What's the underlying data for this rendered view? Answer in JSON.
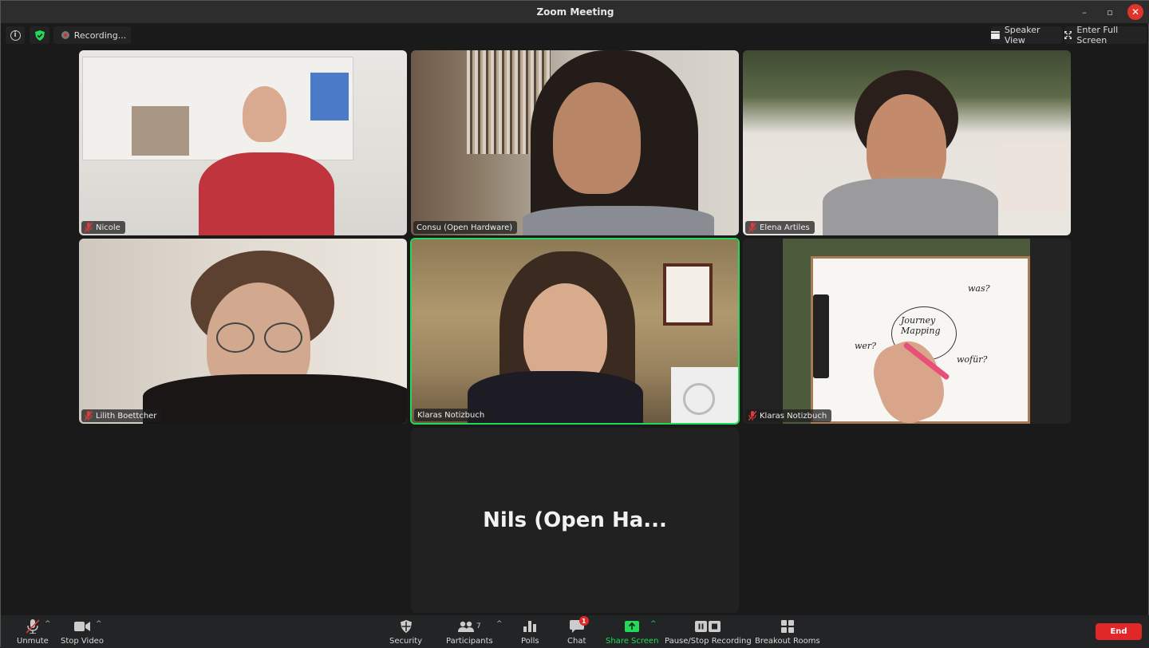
{
  "window": {
    "title": "Zoom Meeting",
    "controls": {
      "minimize": "–",
      "restore": "▫",
      "close": "✕"
    }
  },
  "topbar": {
    "info_icon": "info-icon",
    "security_icon": "shield-check-icon",
    "recording_label": "Recording...",
    "speaker_view_label": "Speaker View",
    "fullscreen_label": "Enter Full Screen"
  },
  "tiles": [
    {
      "name": "Nicole",
      "muted": true,
      "active": false,
      "video": true
    },
    {
      "name": "Consu (Open Hardware)",
      "muted": false,
      "active": false,
      "video": true
    },
    {
      "name": "Elena Artiles",
      "muted": true,
      "active": false,
      "video": true
    },
    {
      "name": "Lilith Boettcher",
      "muted": true,
      "active": false,
      "video": true
    },
    {
      "name": "Klaras Notizbuch",
      "muted": false,
      "active": true,
      "video": true
    },
    {
      "name": "Klaras Notizbuch",
      "muted": true,
      "active": false,
      "video": true
    },
    {
      "name": "Nils (Open Ha...",
      "muted": false,
      "active": false,
      "video": false
    }
  ],
  "whiteboard_text": [
    "was?",
    "Journey Mapping",
    "wofür?",
    "wer?"
  ],
  "toolbar": {
    "unmute": "Unmute",
    "stop_video": "Stop Video",
    "security": "Security",
    "participants": "Participants",
    "participants_count": "7",
    "polls": "Polls",
    "chat": "Chat",
    "chat_badge": "1",
    "share_screen": "Share Screen",
    "pause_stop_recording": "Pause/Stop Recording",
    "breakout_rooms": "Breakout Rooms",
    "end": "End"
  },
  "colors": {
    "active_speaker": "#23d959",
    "end_button": "#e02828",
    "share_screen": "#23d959"
  }
}
